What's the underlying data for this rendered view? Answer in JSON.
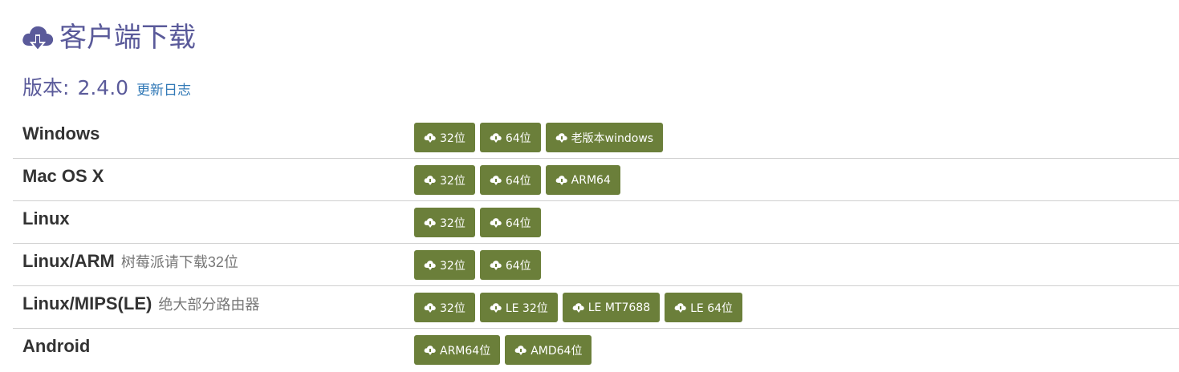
{
  "header": {
    "title": "客户端下载",
    "icon": "cloud-download-icon",
    "icon_color": "#5a5a9a"
  },
  "version": {
    "label": "版本:",
    "value": "2.4.0",
    "changelog_link": "更新日志"
  },
  "colors": {
    "button_bg": "#6b7f3a",
    "title": "#5a5a9a",
    "link": "#337ab7"
  },
  "rows": [
    {
      "name": "Windows",
      "note": "",
      "buttons": [
        "32位",
        "64位",
        "老版本windows"
      ]
    },
    {
      "name": "Mac OS X",
      "note": "",
      "buttons": [
        "32位",
        "64位",
        "ARM64"
      ]
    },
    {
      "name": "Linux",
      "note": "",
      "buttons": [
        "32位",
        "64位"
      ]
    },
    {
      "name": "Linux/ARM",
      "note": "树莓派请下载32位",
      "buttons": [
        "32位",
        "64位"
      ]
    },
    {
      "name": "Linux/MIPS(LE)",
      "note": "绝大部分路由器",
      "buttons": [
        "32位",
        "LE 32位",
        "LE MT7688",
        "LE 64位"
      ]
    },
    {
      "name": "Android",
      "note": "",
      "buttons": [
        "ARM64位",
        "AMD64位"
      ]
    }
  ]
}
